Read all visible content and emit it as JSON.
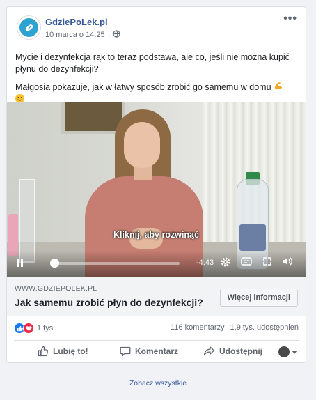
{
  "post": {
    "page_name": "GdziePoLek.pl",
    "timestamp": "10 marca o 14:25",
    "audience_icon": "globe-icon",
    "more_icon": "more-options-icon",
    "text_line1": "Mycie i dezynfekcja rąk to teraz podstawa, ale co, jeśli nie można kupić płynu do dezynfekcji?",
    "text_line2": "Małgosia pokazuje, jak w łatwy sposób zrobić go samemu w domu"
  },
  "video": {
    "caption": "Kliknij, aby rozwinąć",
    "time_remaining": "-4:43",
    "progress": 0.02,
    "controls": [
      "pause-icon",
      "settings-icon",
      "captions-icon",
      "fullscreen-icon",
      "volume-icon"
    ]
  },
  "link_preview": {
    "domain": "WWW.GDZIEPOLEK.PL",
    "title": "Jak samemu zrobić płyn do dezynfekcji?",
    "button": "Więcej informacji"
  },
  "stats": {
    "reactions": "1 tys.",
    "comments": "116 komentarzy",
    "shares": "1,9 tys. udostępnień"
  },
  "actions": {
    "like": "Lubię to!",
    "comment": "Komentarz",
    "share": "Udostępnij"
  },
  "footer": {
    "see_all": "Zobacz wszystkie"
  },
  "colors": {
    "link_blue": "#365899",
    "like_blue": "#1877f2",
    "love_red": "#f02849",
    "brand_teal": "#2fa3d0"
  }
}
